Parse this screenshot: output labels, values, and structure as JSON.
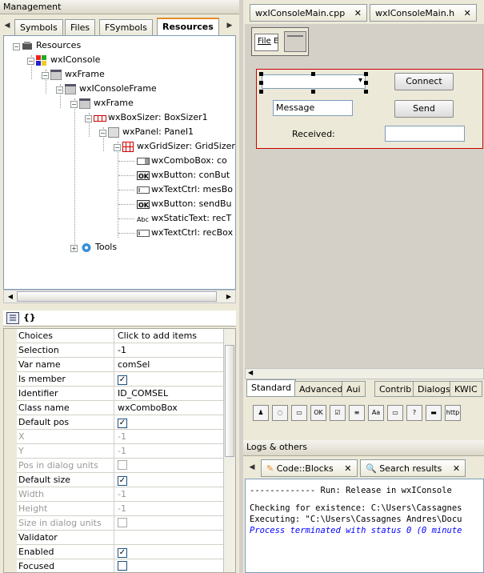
{
  "management": {
    "title": "Management",
    "tabs": [
      "Symbols",
      "Files",
      "FSymbols",
      "Resources"
    ],
    "active_tab": "Resources"
  },
  "tree": {
    "root": "Resources",
    "items": [
      {
        "label": "wxIConsole"
      },
      {
        "label": "wxFrame"
      },
      {
        "label": "wxIConsoleFrame"
      },
      {
        "label": "wxFrame"
      },
      {
        "label": "wxBoxSizer: BoxSizer1"
      },
      {
        "label": "wxPanel: Panel1"
      },
      {
        "label": "wxGridSizer: GridSizer"
      },
      {
        "label": "wxComboBox: co"
      },
      {
        "label": "wxButton: conBut"
      },
      {
        "label": "wxTextCtrl: mesBo"
      },
      {
        "label": "wxButton: sendBu"
      },
      {
        "label": "wxStaticText: recT"
      },
      {
        "label": "wxTextCtrl: recBox"
      },
      {
        "label": "Tools"
      }
    ]
  },
  "propbar": {
    "braces": "{}"
  },
  "properties": [
    {
      "name": "Choices",
      "value": "Click to add items",
      "type": "text",
      "disabled": false
    },
    {
      "name": "Selection",
      "value": "-1",
      "type": "text",
      "disabled": false
    },
    {
      "name": "Var name",
      "value": "comSel",
      "type": "text",
      "disabled": false
    },
    {
      "name": "Is member",
      "value": "✓",
      "type": "check",
      "disabled": false
    },
    {
      "name": "Identifier",
      "value": "ID_COMSEL",
      "type": "text",
      "disabled": false
    },
    {
      "name": "Class name",
      "value": "wxComboBox",
      "type": "text",
      "disabled": false
    },
    {
      "name": "Default pos",
      "value": "✓",
      "type": "check",
      "disabled": false
    },
    {
      "name": "X",
      "value": "-1",
      "type": "text",
      "disabled": true
    },
    {
      "name": "Y",
      "value": "-1",
      "type": "text",
      "disabled": true
    },
    {
      "name": "Pos in dialog units",
      "value": "",
      "type": "check",
      "disabled": true
    },
    {
      "name": "Default size",
      "value": "✓",
      "type": "check",
      "disabled": false
    },
    {
      "name": "Width",
      "value": "-1",
      "type": "text",
      "disabled": true
    },
    {
      "name": "Height",
      "value": "-1",
      "type": "text",
      "disabled": true
    },
    {
      "name": "Size in dialog units",
      "value": "",
      "type": "check",
      "disabled": true
    },
    {
      "name": "Validator",
      "value": "",
      "type": "text",
      "disabled": false
    },
    {
      "name": "Enabled",
      "value": "✓",
      "type": "check",
      "disabled": false
    },
    {
      "name": "Focused",
      "value": "",
      "type": "check",
      "disabled": false
    }
  ],
  "editor": {
    "tabs": [
      "wxIConsoleMain.cpp",
      "wxIConsoleMain.h"
    ],
    "toolbar_file": "File",
    "toolbar_edit": "E"
  },
  "form": {
    "connect_label": "Connect",
    "message_value": "Message",
    "send_label": "Send",
    "received_label": "Received:",
    "combo_arrow": "▾"
  },
  "palette": {
    "tabs": [
      "Standard",
      "Advanced",
      "Aui",
      "Contrib",
      "Dialogs",
      "KWIC"
    ],
    "active_tab": "Standard",
    "icons": [
      "OK",
      "☑",
      "≡",
      "Aa",
      "▭",
      "?",
      "▬",
      "http"
    ]
  },
  "logs": {
    "title": "Logs & others",
    "tabs": [
      "Code::Blocks",
      "Search results"
    ],
    "lines": [
      {
        "text": "------------- Run: Release in wxIConsole",
        "color": "#000000"
      },
      {
        "text": "Checking for existence: C:\\Users\\Cassagnes",
        "color": "#000000"
      },
      {
        "text": "Executing: \"C:\\Users\\Cassagnes Andres\\Docu",
        "color": "#000000"
      },
      {
        "text": "Process terminated with status 0 (0 minute",
        "color": "#0000ff"
      }
    ]
  },
  "colors": {
    "accent": "#e68b2c",
    "selection_border": "#cc0000"
  }
}
